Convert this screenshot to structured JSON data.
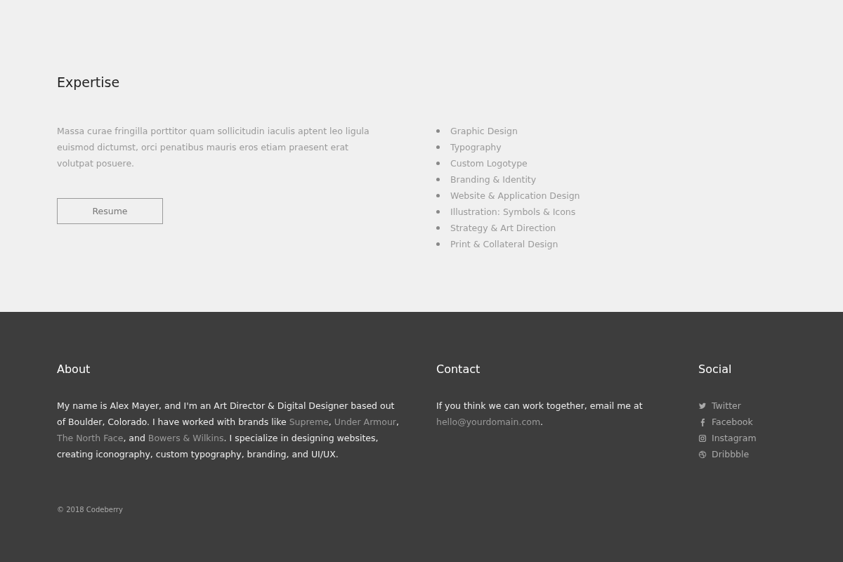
{
  "expertise": {
    "heading": "Expertise",
    "text": "Massa curae fringilla porttitor quam sollicitudin iaculis aptent leo ligula euismod dictumst, orci penatibus mauris eros etiam praesent erat volutpat posuere.",
    "button": "Resume",
    "skills": [
      "Graphic Design",
      "Typography",
      "Custom Logotype",
      "Branding & Identity",
      "Website & Application Design",
      "Illustration: Symbols & Icons",
      "Strategy & Art Direction",
      "Print & Collateral Design"
    ]
  },
  "footer": {
    "about": {
      "heading": "About",
      "parts": [
        {
          "kind": "text",
          "text": "My name is Alex Mayer, and I'm an Art Director & Digital Designer based out of Boulder, Colorado. I have worked with brands like "
        },
        {
          "kind": "link",
          "text": "Supreme"
        },
        {
          "kind": "text",
          "text": ", "
        },
        {
          "kind": "link",
          "text": "Under Armour"
        },
        {
          "kind": "text",
          "text": ", "
        },
        {
          "kind": "link",
          "text": "The North Face"
        },
        {
          "kind": "text",
          "text": ", and "
        },
        {
          "kind": "link",
          "text": "Bowers & Wilkins"
        },
        {
          "kind": "text",
          "text": ". I specialize in designing websites, creating iconography, custom typography, branding, and UI/UX."
        }
      ]
    },
    "contact": {
      "heading": "Contact",
      "parts": [
        {
          "kind": "text",
          "text": "If you think we can work together, email me at "
        },
        {
          "kind": "link",
          "text": "hello@yourdomain.com"
        },
        {
          "kind": "text",
          "text": "."
        }
      ]
    },
    "social": {
      "heading": "Social",
      "links": [
        {
          "kind": "twitter",
          "label": "Twitter"
        },
        {
          "kind": "facebook",
          "label": "Facebook"
        },
        {
          "kind": "instagram",
          "label": "Instagram"
        },
        {
          "kind": "dribbble",
          "label": "Dribbble"
        }
      ]
    },
    "copyright": "© 2018 Codeberry"
  }
}
